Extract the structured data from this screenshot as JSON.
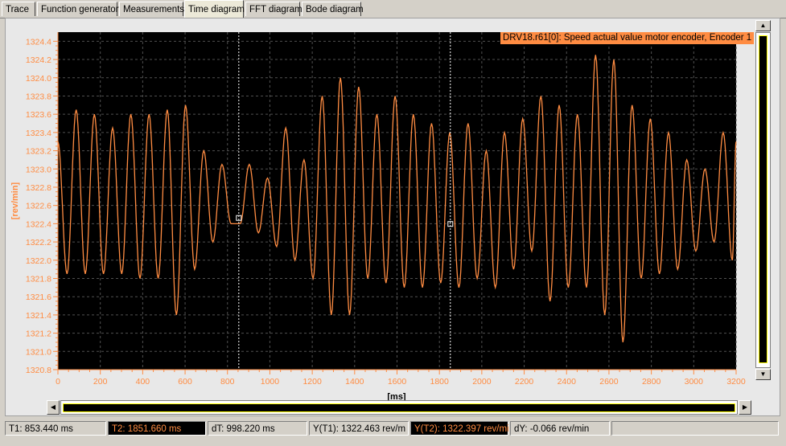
{
  "tabs": [
    "Trace",
    "Function generator",
    "Measurements",
    "Time diagram",
    "FFT diagram",
    "Bode diagram"
  ],
  "active_tab": "Time diagram",
  "plot": {
    "legend": "DRV18.r61[0]: Speed actual value motor encoder, Encoder 1",
    "ylabel": "[rev/min]",
    "xlabel": "[ms]",
    "colors": {
      "background": "#000000",
      "trace": "#ff8c42",
      "grid": "#505050",
      "axis": "#ff8c42",
      "cursor": "#ffffff"
    },
    "cursors": [
      {
        "name": "T1",
        "x": 853.44,
        "y": 1322.463
      },
      {
        "name": "T2",
        "x": 1851.66,
        "y": 1322.397
      }
    ]
  },
  "chart_data": {
    "type": "line",
    "xlabel": "[ms]",
    "ylabel": "[rev/min]",
    "xlim": [
      0,
      3200
    ],
    "ylim": [
      1320.8,
      1324.5
    ],
    "xticks": [
      0,
      200,
      400,
      600,
      800,
      1000,
      1200,
      1400,
      1600,
      1800,
      2000,
      2200,
      2400,
      2600,
      2800,
      3000,
      3200
    ],
    "yticks": [
      1320.8,
      1321.0,
      1321.2,
      1321.4,
      1321.6,
      1321.8,
      1322.0,
      1322.2,
      1322.4,
      1322.6,
      1322.8,
      1323.0,
      1323.2,
      1323.4,
      1323.6,
      1323.8,
      1324.0,
      1324.2,
      1324.4
    ],
    "grid": true,
    "series": [
      {
        "name": "DRV18.r61[0]: Speed actual value motor encoder, Encoder 1",
        "x": [
          0,
          43,
          86,
          129,
          172,
          215,
          258,
          301,
          344,
          387,
          430,
          473,
          516,
          559,
          602,
          645,
          688,
          731,
          774,
          817,
          860,
          903,
          946,
          989,
          1032,
          1075,
          1118,
          1161,
          1204,
          1247,
          1290,
          1333,
          1376,
          1419,
          1462,
          1505,
          1548,
          1591,
          1634,
          1677,
          1720,
          1763,
          1806,
          1849,
          1892,
          1935,
          1978,
          2021,
          2064,
          2107,
          2150,
          2193,
          2236,
          2279,
          2322,
          2365,
          2408,
          2451,
          2494,
          2537,
          2580,
          2623,
          2666,
          2709,
          2752,
          2795,
          2838,
          2881,
          2924,
          2967,
          3010,
          3053,
          3096,
          3139,
          3182,
          3200
        ],
        "y": [
          1323.3,
          1321.85,
          1323.65,
          1321.85,
          1323.6,
          1321.85,
          1323.45,
          1321.85,
          1323.6,
          1321.8,
          1323.6,
          1321.8,
          1323.65,
          1321.4,
          1323.7,
          1321.9,
          1323.2,
          1322.2,
          1323.05,
          1322.4,
          1322.4,
          1323.05,
          1322.3,
          1322.9,
          1322.15,
          1323.45,
          1322.0,
          1323.1,
          1321.8,
          1323.8,
          1321.4,
          1324.0,
          1321.4,
          1323.9,
          1321.8,
          1323.6,
          1321.75,
          1323.8,
          1321.7,
          1323.6,
          1321.7,
          1323.5,
          1321.75,
          1323.4,
          1321.7,
          1323.5,
          1321.8,
          1323.2,
          1321.7,
          1323.4,
          1321.9,
          1323.55,
          1322.1,
          1323.8,
          1321.55,
          1323.7,
          1321.7,
          1323.6,
          1321.7,
          1324.25,
          1321.4,
          1324.2,
          1321.1,
          1323.7,
          1321.8,
          1323.55,
          1321.85,
          1323.4,
          1321.9,
          1323.1,
          1322.1,
          1323.0,
          1322.2,
          1323.4,
          1322.0,
          1323.3
        ]
      }
    ]
  },
  "status": {
    "t1": "T1: 853.440 ms",
    "t2": "T2: 1851.660 ms",
    "dt": "dT: 998.220 ms",
    "yt1": "Y(T1):  1322.463 rev/m",
    "yt2": "Y(T2): 1322.397 rev/mi",
    "dy": "dY: -0.066 rev/min"
  }
}
